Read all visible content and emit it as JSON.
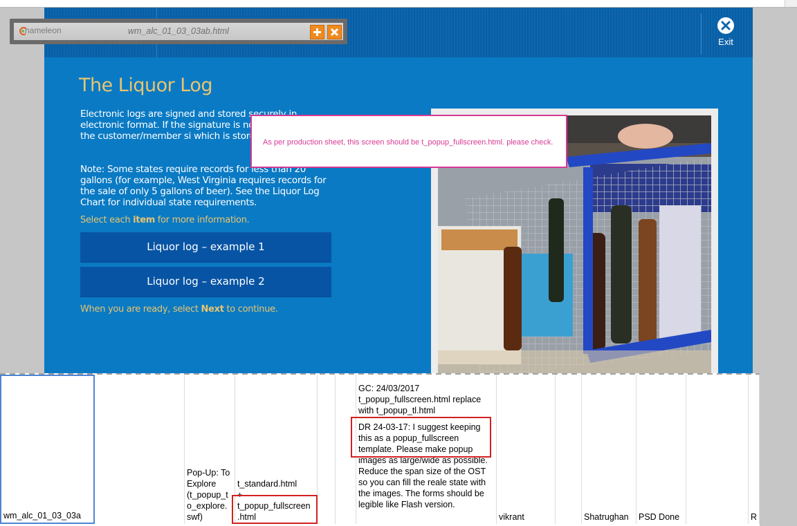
{
  "window": {
    "file_name": "wm_alc_01_03_03ab.html",
    "logo_text": "hameleon",
    "logo_letter": "C"
  },
  "header": {
    "exit_label": "Exit"
  },
  "content": {
    "title": "The Liquor Log",
    "paragraph1": "Electronic logs are signed and stored securely in electronic format.  If the signature is not electronically, the customer/member si which is stored for three years.",
    "paragraph2": "Note: Some states require records for less than 20 gallons (for example, West Virginia requires records for the sale of only 5 gallons of beer).  See the Liquor Log Chart for individual state requirements.",
    "select_prefix": "Select each ",
    "select_bold": "item",
    "select_suffix": " for more information.",
    "button1": "Liquor log – example 1",
    "button2": "Liquor log – example 2",
    "ready_prefix": "When you are ready, select ",
    "ready_bold": "Next",
    "ready_suffix": " to continue."
  },
  "review_note": "As per production sheet, this screen should be t_popup_fullscreen.html. please check.",
  "sheet_row": {
    "screen_id": "wm_alc_01_03_03a",
    "interaction": "Pop-Up: To Explore (t_popup_t o_explore. swf)",
    "template_line1": "t_standard.html",
    "template_line2": "+",
    "template_line3": "t_popup_fullscreen .html",
    "comment1": "GC: 24/03/2017 t_popup_fullscreen.html replace with t_popup_tl.html",
    "comment2": "DR 24-03-17: I suggest keeping this as a popup_fullscreen template. Please make popup images as large/wide as possible. Reduce the span size of the OST so you can fill the reale state with the images. The forms should be legible like Flash version.",
    "developer": "vikrant",
    "reviewer": "Shatrughan",
    "status": "PSD Done",
    "last_col": "R"
  },
  "colors": {
    "stage_blue": "#0a7ac4",
    "title_gold": "#e9c46f",
    "button_blue": "#0854a4",
    "note_pink": "#d63894",
    "highlight_red": "#d22020"
  }
}
